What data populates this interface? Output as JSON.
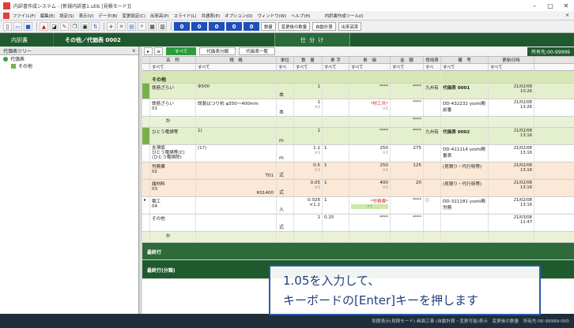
{
  "window": {
    "title": "内訳書作成システム - [新規内訳書1.utib [見積モード]]",
    "controls": [
      "–",
      "□",
      "✕"
    ]
  },
  "menu": {
    "items": [
      "ファイル(F)",
      "編集(E)",
      "設定(S)",
      "表示(V)",
      "データ(B)",
      "変更設定(C)",
      "出来高(P)",
      "スライド(L)",
      "共通表(E)",
      "オプション(O)",
      "ウィンドウ(W)",
      "ヘルプ(H)"
    ],
    "extra": "内訳書作成ツール(I)"
  },
  "toolbar": {
    "num_boxes": [
      "0",
      "0",
      "0",
      "0",
      "0"
    ],
    "select1": "数量",
    "select2": "変更後の数量",
    "select3": "自動計算",
    "select4": "出来高率"
  },
  "tabs": {
    "main": "内訳書",
    "current": "その他／代価表 0002",
    "right": "仕 分 け"
  },
  "left_panel": {
    "title": "代価表ツリー",
    "close": "x",
    "tree": [
      "代価表",
      "その他"
    ]
  },
  "filterbar": {
    "buttons": [
      "すべて",
      "代価表分類",
      "代価表一覧"
    ],
    "right_label": "所有先:00-99999"
  },
  "columns": {
    "headers": [
      "",
      "名　称",
      "規　格",
      "単位",
      "数　量",
      "単 手",
      "単　価",
      "金　額",
      "常用表",
      "備　考",
      "更新日時"
    ],
    "filters": [
      "",
      "すべて",
      "すべて",
      "すべ",
      "すべて",
      "すべて",
      "すべて",
      "すべて",
      "すべ",
      "すべて",
      "すべて"
    ]
  },
  "rows": {
    "section": "その他",
    "r1": {
      "name": "鉄筋ざらい",
      "spec": "Φ500",
      "unit": "本",
      "qty": "1",
      "price": "****",
      "amount": "****",
      "mark": "九州有",
      "note": "代価表 0001",
      "date": "21/02/08",
      "time": "10:26"
    },
    "r2": {
      "no": "01",
      "name": "鉄筋ざらい",
      "spec": "既製はつり杭 φ350〜400mm",
      "unit": "本",
      "qty": "1",
      "qty_sub": "×1",
      "price": "*材工共*",
      "price_sub": "×1",
      "amount": "****",
      "note": "DD-432232 yoshi殿",
      "note2": "前番",
      "date": "21/02/08",
      "time": "13:26"
    },
    "r3": {
      "name": "計",
      "amount": "****"
    },
    "r4": {
      "name": "ひとう電掃等",
      "spec": "1)",
      "unit": "m",
      "qty": "1",
      "price": "****",
      "amount": "****",
      "mark": "九州有",
      "note": "代価表 0002",
      "date": "21/02/08",
      "time": "13:16"
    },
    "r5": {
      "no": "01",
      "name": "支滑設",
      "name2": "ひとう電掃等(C)",
      "name3": "(ひとう電掃除)",
      "spec": "(1?)",
      "unit": "m",
      "qty": "1.1",
      "qty_sub": "×1",
      "qty2": "1",
      "price": "250",
      "price_sub": "×1",
      "amount": "275",
      "note": "DD-411114 yoshi殿",
      "note2": "番表",
      "date": "21/02/08",
      "time": "13:16"
    },
    "r6": {
      "no": "02",
      "name": "労務費",
      "unit": "式",
      "qty": "0.5",
      "qty_sub": "×1",
      "qty2": "1",
      "price": "250",
      "price_sub": "×1",
      "amount": "125",
      "note": "(見積り・代行特等)",
      "date": "21/02/08",
      "time": "13:16",
      "unit_code": "T01"
    },
    "r7": {
      "no": "03",
      "name": "諸材料",
      "unit": "式",
      "qty": "0.05",
      "qty_sub": "×1",
      "qty2": "1",
      "price": "400",
      "price_sub": "×1",
      "amount": "20",
      "note": "(見積り・代行特等)",
      "date": "21/02/08",
      "time": "13:16",
      "unit_code": "K01400"
    },
    "r8": {
      "no": "04",
      "name": "電工",
      "unit": "人",
      "qty": "0.026",
      "qty_sub": "×1.2",
      "qty2": "1",
      "price": "*労務費*",
      "price_sub": "×1",
      "amount": "****",
      "mark": "○",
      "note": "DD-311181 yoshi殿",
      "note2": "労務",
      "date": "21/02/08",
      "time": "13:16"
    },
    "r9": {
      "name": "その他",
      "unit": "式",
      "qty": "1",
      "qty2": "0.25",
      "price": "****",
      "amount": "****",
      "date": "21/03/08",
      "time": "11:47"
    },
    "r10": {
      "name": "計"
    },
    "final1": "最終行",
    "final2": "最終行(分類)"
  },
  "status": "和暦表示(見積モード) 画面工事 (自動計算・変更可能)表示　変更後の数量　所有先:00-99999-000",
  "callout": {
    "line1": "1.05を入力して、",
    "line2": "キーボードの[Enter]キーを押します"
  }
}
